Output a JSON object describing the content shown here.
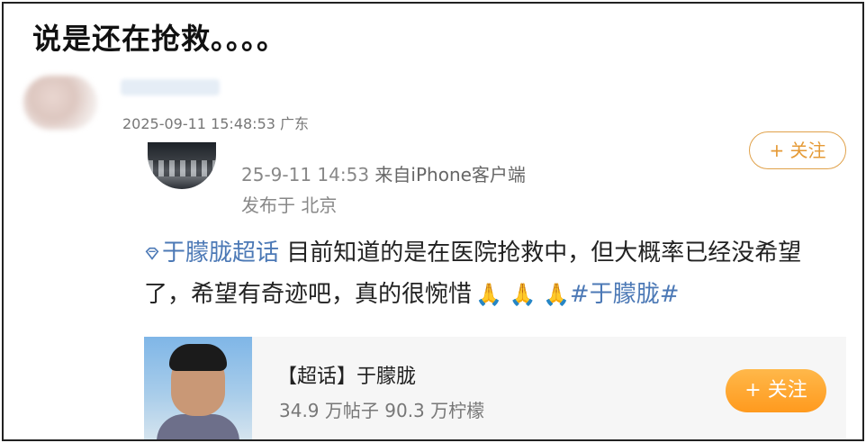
{
  "headline": "说是还在抢救。。。。",
  "commenter": {
    "meta": "2025-09-11 15:48:53 广东"
  },
  "post": {
    "time": "25-9-11 14:53",
    "source_prefix": " 来自",
    "source_app": "iPhone客户端",
    "location": "发布于 北京",
    "follow_top_label": "+ 关注",
    "topic_link": "于朦胧超话",
    "text": " 目前知道的是在医院抢救中，但大概率已经没希望了，希望有奇迹吧，真的很惋惜",
    "emojis": "🙏 🙏 🙏",
    "hashtag": "#于朦胧#"
  },
  "topic_card": {
    "title": "【超话】于朦胧",
    "stats": "34.9 万帖子  90.3 万柠檬",
    "follow_label": "+ 关注"
  },
  "colors": {
    "link": "#4c79b6",
    "accent": "#ff9a1e"
  }
}
